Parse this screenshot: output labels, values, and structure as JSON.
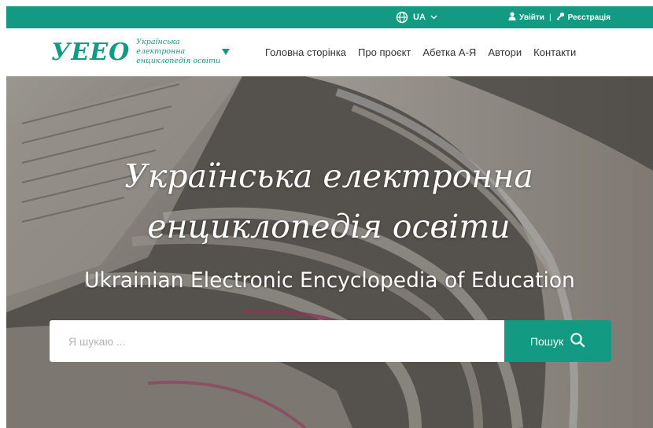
{
  "topbar": {
    "language": "UA",
    "login": "Увійти",
    "separator": "|",
    "register": "Реєстрація",
    "icons": [
      "globe-icon",
      "chevron-down-icon",
      "user-icon",
      "key-icon"
    ]
  },
  "header": {
    "logo_mark": "УЕЕО",
    "logo_text_line1": "Українська електронна",
    "logo_text_line2": "енциклопедія освіти",
    "nav": [
      "Головна сторінка",
      "Про проєкт",
      "Абетка А-Я",
      "Автори",
      "Контакти"
    ]
  },
  "hero": {
    "title_line1": "Українська електронна",
    "title_line2": "енциклопедія освіти",
    "subtitle": "Ukrainian Electronic Encyclopedia of Education",
    "search_placeholder": "Я шукаю ...",
    "search_button": "Пошук"
  },
  "colors": {
    "accent": "#139a82",
    "text": "#333333",
    "white": "#ffffff"
  }
}
